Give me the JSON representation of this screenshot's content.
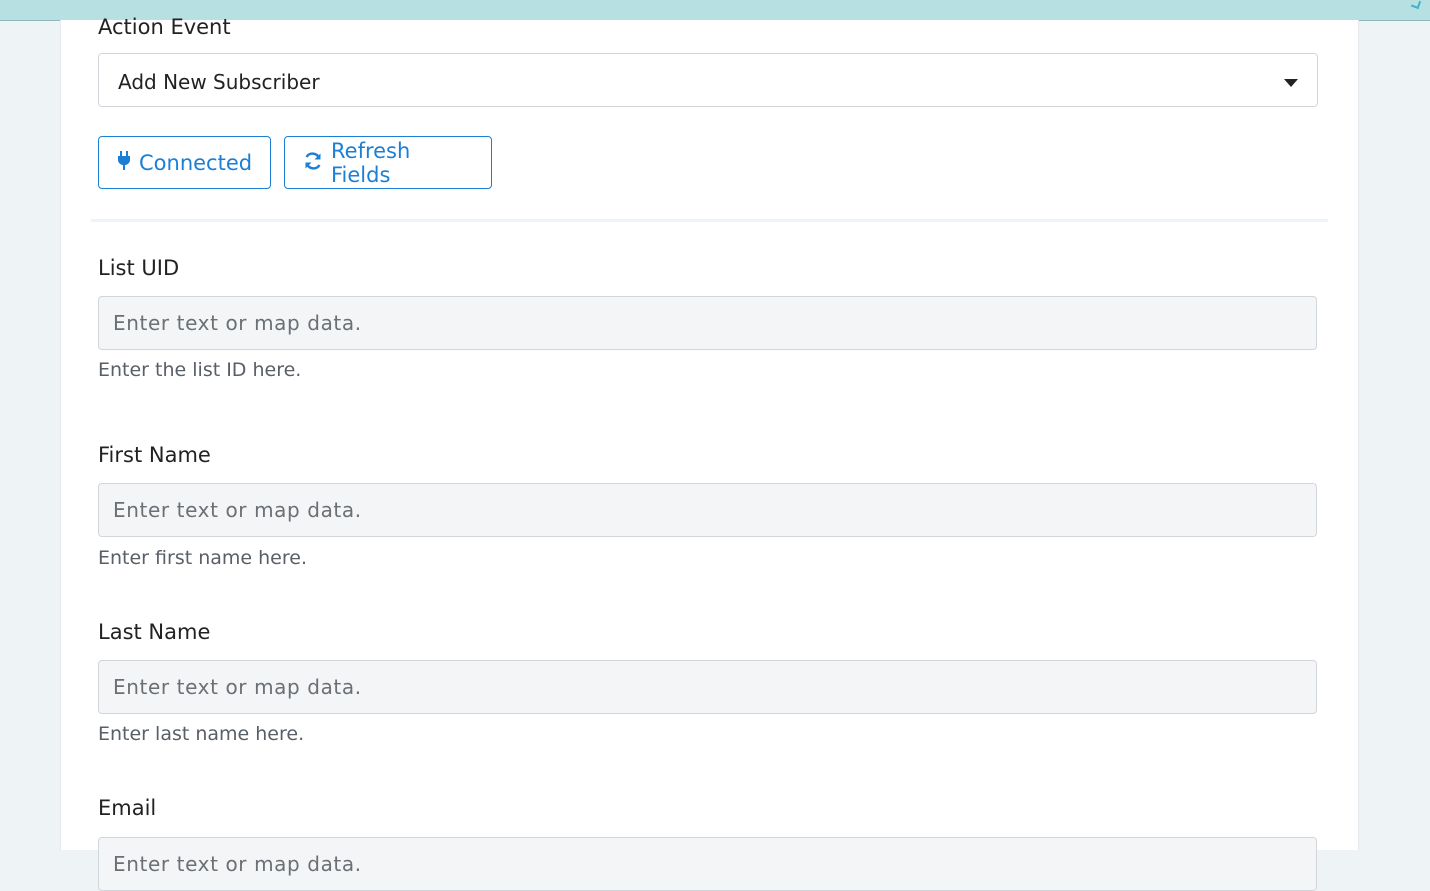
{
  "form": {
    "action_event": {
      "label": "Action Event",
      "selected": "Add New Subscriber"
    },
    "buttons": {
      "connected": {
        "label": "Connected",
        "icon": "plug-icon"
      },
      "refresh": {
        "label": "Refresh Fields",
        "icon": "refresh-icon"
      }
    },
    "fields": [
      {
        "label": "List UID",
        "placeholder": "Enter text or map data.",
        "hint": "Enter the list ID here."
      },
      {
        "label": "First Name",
        "placeholder": "Enter text or map data.",
        "hint": "Enter first name here."
      },
      {
        "label": "Last Name",
        "placeholder": "Enter text or map data.",
        "hint": "Enter last name here."
      },
      {
        "label": "Email",
        "placeholder": "Enter text or map data."
      }
    ]
  },
  "colors": {
    "accent": "#1c7fd6",
    "topbar": "#b7e0e3",
    "input_bg": "#f3f5f7",
    "page_bg": "#eef3f6"
  }
}
